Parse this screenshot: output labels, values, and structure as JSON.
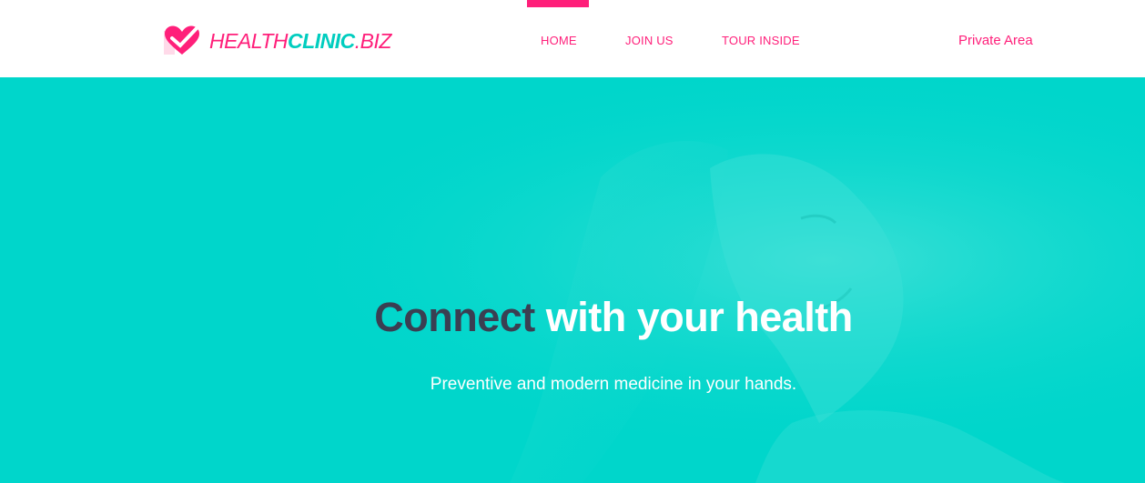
{
  "brand": {
    "part1": "HEALTH",
    "part2": "CLINIC",
    "part3": ".BIZ",
    "icon": "heart-check-icon"
  },
  "nav": {
    "items": [
      {
        "label": "HOME",
        "active": true
      },
      {
        "label": "JOIN US",
        "active": false
      },
      {
        "label": "TOUR INSIDE",
        "active": false
      }
    ],
    "private_area": "Private Area"
  },
  "hero": {
    "headline_dark": "Connect",
    "headline_light": "with your health",
    "subheadline": "Preventive and modern medicine in your hands."
  },
  "colors": {
    "accent_pink": "#ff1f7a",
    "hero_teal": "#00d6cb",
    "logo_teal": "#00cdbf",
    "headline_dark": "#3a3f52"
  }
}
